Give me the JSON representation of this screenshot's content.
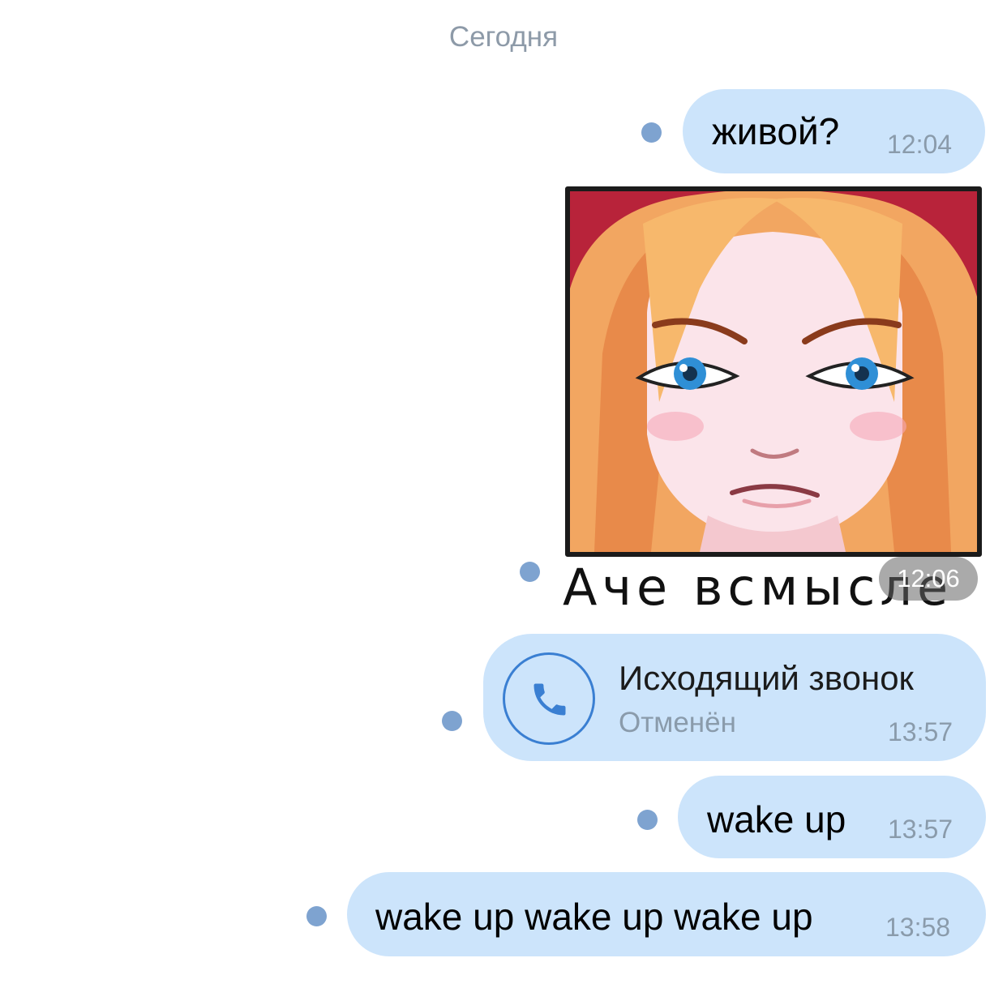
{
  "chat": {
    "date_separator": "Сегодня",
    "messages": [
      {
        "type": "text",
        "text": "живой?",
        "time": "12:04"
      },
      {
        "type": "sticker",
        "caption": "Аче всмысле",
        "time": "12:06",
        "image": "angry-blonde-girl-sticker"
      },
      {
        "type": "call",
        "title": "Исходящий звонок",
        "status": "Отменён",
        "time": "13:57",
        "icon": "phone-icon"
      },
      {
        "type": "text",
        "text": "wake up",
        "time": "13:57"
      },
      {
        "type": "text",
        "text": "wake up wake up wake up",
        "time": "13:58"
      }
    ]
  },
  "colors": {
    "bubble": "#cce4fb",
    "unread_dot": "#7ea3d0",
    "call_accent": "#3a7fd2",
    "timestamp": "#8a9bab"
  }
}
